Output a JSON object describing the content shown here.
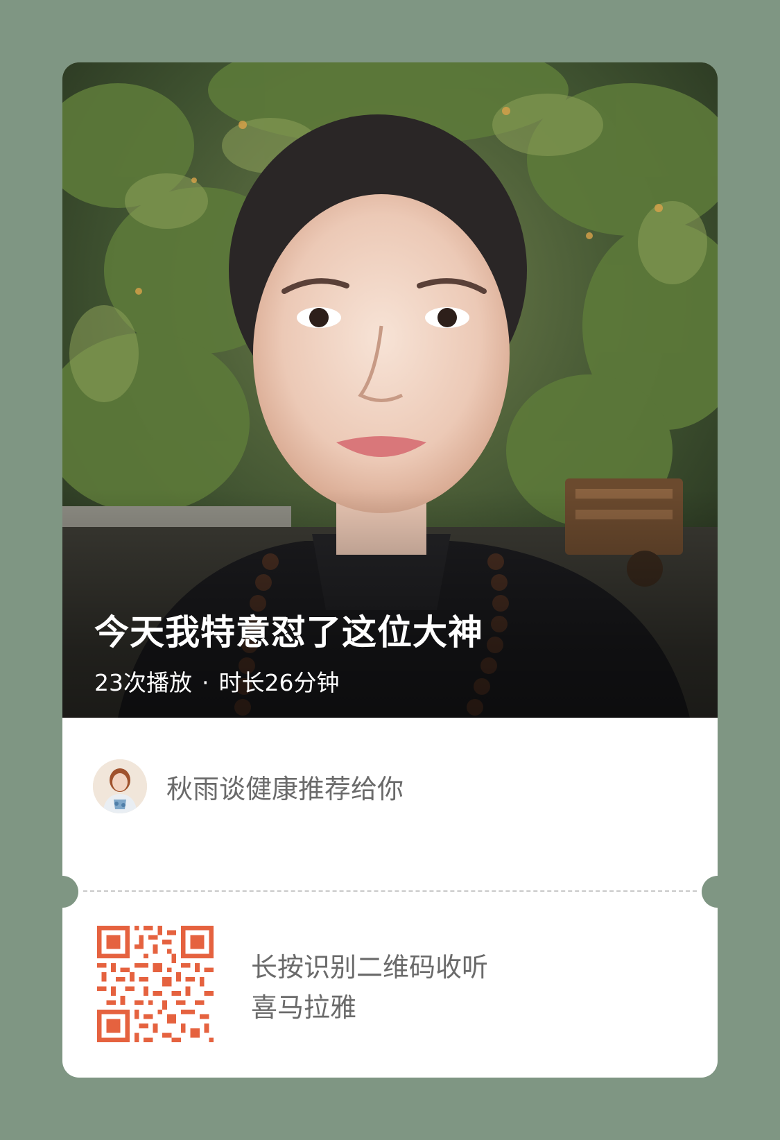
{
  "colors": {
    "page_background": "#7f9683",
    "card_background": "#ffffff",
    "qr_color": "#e5623f",
    "secondary_text": "#6a6a6a"
  },
  "cover": {
    "title": "今天我特意怼了这位大神",
    "play_count": "23次播放",
    "separator": "·",
    "duration": "时长26分钟"
  },
  "recommender": {
    "avatar_icon": "user-avatar",
    "text": "秋雨谈健康推荐给你"
  },
  "qr_section": {
    "icon": "qr-code",
    "line1": "长按识别二维码收听",
    "line2": "喜马拉雅"
  }
}
